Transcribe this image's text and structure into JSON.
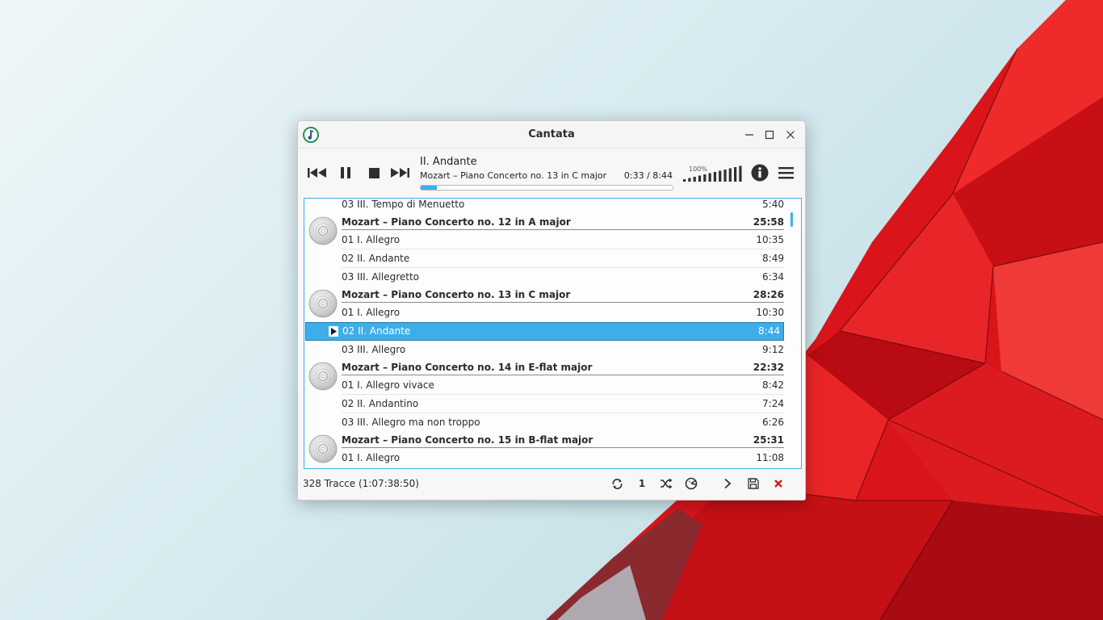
{
  "window": {
    "title": "Cantata"
  },
  "now_playing": {
    "title": "II. Andante",
    "subtitle": "Mozart – Piano Concerto no. 13 in C major",
    "time": "0:33 / 8:44",
    "progress": 0.063
  },
  "volume": {
    "label": "100%",
    "level": 1.0
  },
  "icons": {
    "app": "cantata-icon",
    "minimize": "minimize-icon",
    "maximize": "maximize-icon",
    "close": "close-icon",
    "prev": "skip-previous-icon",
    "pause": "pause-icon",
    "stop": "stop-icon",
    "next": "skip-next-icon",
    "info": "info-icon",
    "menu": "hamburger-menu-icon",
    "album": "cd-icon",
    "playing": "play-indicator-icon"
  },
  "colors": {
    "accent": "#3daee9",
    "clear": "#cc1d1d",
    "wallpaper_red": "#e0171c"
  },
  "playlist": {
    "rows": [
      {
        "type": "track",
        "title": "03 III. Tempo di Menuetto",
        "duration": "5:40"
      },
      {
        "type": "album",
        "title": "Mozart – Piano Concerto no. 12 in A major",
        "duration": "25:58"
      },
      {
        "type": "track",
        "title": "01 I. Allegro",
        "duration": "10:35"
      },
      {
        "type": "track",
        "title": "02 II. Andante",
        "duration": "8:49"
      },
      {
        "type": "track",
        "title": "03 III. Allegretto",
        "duration": "6:34"
      },
      {
        "type": "album",
        "title": "Mozart – Piano Concerto no. 13 in C major",
        "duration": "28:26"
      },
      {
        "type": "track",
        "title": "01 I. Allegro",
        "duration": "10:30"
      },
      {
        "type": "track",
        "title": "02 II. Andante",
        "duration": "8:44",
        "selected": true,
        "playing": true
      },
      {
        "type": "track",
        "title": "03 III. Allegro",
        "duration": "9:12"
      },
      {
        "type": "album",
        "title": "Mozart – Piano Concerto no. 14 in E-flat major",
        "duration": "22:32"
      },
      {
        "type": "track",
        "title": "01 I. Allegro vivace",
        "duration": "8:42"
      },
      {
        "type": "track",
        "title": "02 II. Andantino",
        "duration": "7:24"
      },
      {
        "type": "track",
        "title": "03 III. Allegro ma non troppo",
        "duration": "6:26"
      },
      {
        "type": "album",
        "title": "Mozart – Piano Concerto no. 15 in B-flat major",
        "duration": "25:31"
      },
      {
        "type": "track",
        "title": "01 I. Allegro",
        "duration": "11:08"
      }
    ]
  },
  "status": {
    "summary": "328 Tracce (1:07:38:50)",
    "single_label": "1",
    "buttons": [
      "repeat-icon",
      "single-icon",
      "shuffle-icon",
      "consume-icon",
      "expand-icon",
      "save-icon",
      "clear-playlist-icon"
    ]
  }
}
